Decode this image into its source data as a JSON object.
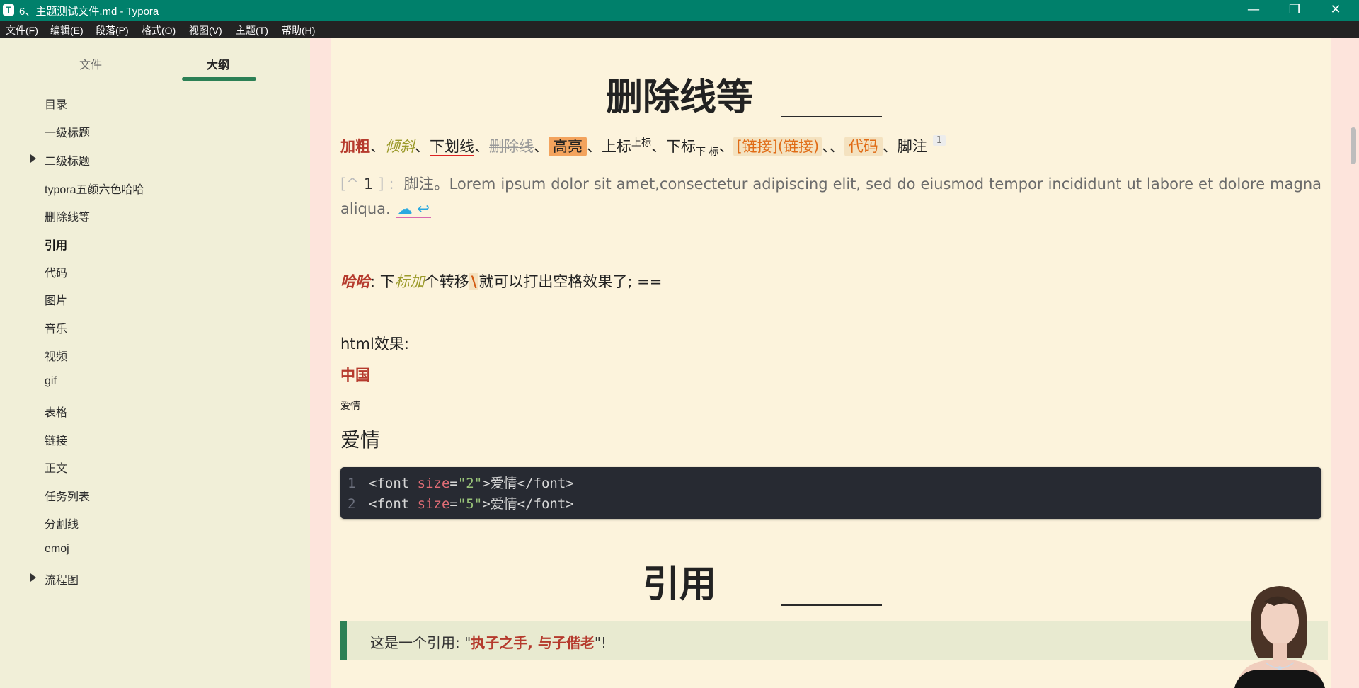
{
  "window": {
    "app_icon": "T",
    "title": "6、主题测试文件.md - Typora",
    "minimize_icon": "minimize-icon",
    "maximize_icon": "restore-icon",
    "close_icon": "close-icon"
  },
  "menu": [
    "文件(F)",
    "编辑(E)",
    "段落(P)",
    "格式(O)",
    "视图(V)",
    "主题(T)",
    "帮助(H)"
  ],
  "sidebar": {
    "tabs": [
      "文件",
      "大纲"
    ],
    "active_tab": "大纲",
    "outline": [
      {
        "label": "目录"
      },
      {
        "label": "一级标题"
      },
      {
        "label": "二级标题",
        "collapsed": true
      },
      {
        "label": "typora五颜六色哈哈"
      },
      {
        "label": "删除线等"
      },
      {
        "label": "引用",
        "active": true
      },
      {
        "label": "代码"
      },
      {
        "label": "图片"
      },
      {
        "label": "音乐"
      },
      {
        "label": "视频"
      },
      {
        "label": "gif"
      },
      {
        "label": "表格"
      },
      {
        "label": "链接"
      },
      {
        "label": "正文"
      },
      {
        "label": "任务列表"
      },
      {
        "label": "分割线"
      },
      {
        "label": "emoj"
      },
      {
        "label": "流程图",
        "collapsed": true
      }
    ]
  },
  "editor": {
    "heading1": "删除线等",
    "inline_row": {
      "bold": "加粗",
      "sep1": "、",
      "italic": "倾斜",
      "sep2": "、",
      "underline": "下划线",
      "sep3": "、",
      "strike": "删除线",
      "sep4": "、",
      "highlight": "高亮",
      "sep5": "、上标",
      "sup": "上标",
      "sep6": "、下标",
      "sub": "下 标",
      "sep7": "、",
      "link": "[链接](链接)",
      "sep8": "、、",
      "code": "代码",
      "sep9": "、脚注",
      "fn_ref": "1"
    },
    "footnote": {
      "open": "[^",
      "num": "1",
      "close": "] :",
      "text": "脚注。Lorem ipsum dolor sit amet,consectetur adipiscing elit, sed do eiusmod tempor incididunt ut labore et dolore magna aliqua.",
      "back_icon": "cloud-return-icon",
      "back_glyph": "☁ ↩"
    },
    "haha_row": {
      "bold": "哈哈",
      "colon": ": 下",
      "italic": "标加",
      "mid": "个转移",
      "slash": "\\",
      "rest": "就可以打出空格效果了; =="
    },
    "html_label": "html效果:",
    "china": "中国",
    "love_small": "爱情",
    "love_large": "爱情",
    "code_lines": [
      {
        "num": "1",
        "tag_open": "<font ",
        "attr": "size",
        "eq": "=",
        "val": "\"2\"",
        "after": ">爱情</font>"
      },
      {
        "num": "2",
        "tag_open": "<font ",
        "attr": "size",
        "eq": "=",
        "val": "\"5\"",
        "after": ">爱情</font>"
      }
    ],
    "heading2": "引用",
    "quote": {
      "pre": "这是一个引用: \"",
      "bold": "执子之手, 与子偕老",
      "post": "\"!"
    },
    "avatar_name": "portrait-avatar-icon"
  },
  "colors": {
    "titlebar": "#00806b",
    "menubar": "#232323",
    "sidebar": "#f1efd8",
    "editor": "#fcf3dc",
    "accent": "#2c8055",
    "red": "#b53a2d",
    "orange": "#e06b15"
  }
}
